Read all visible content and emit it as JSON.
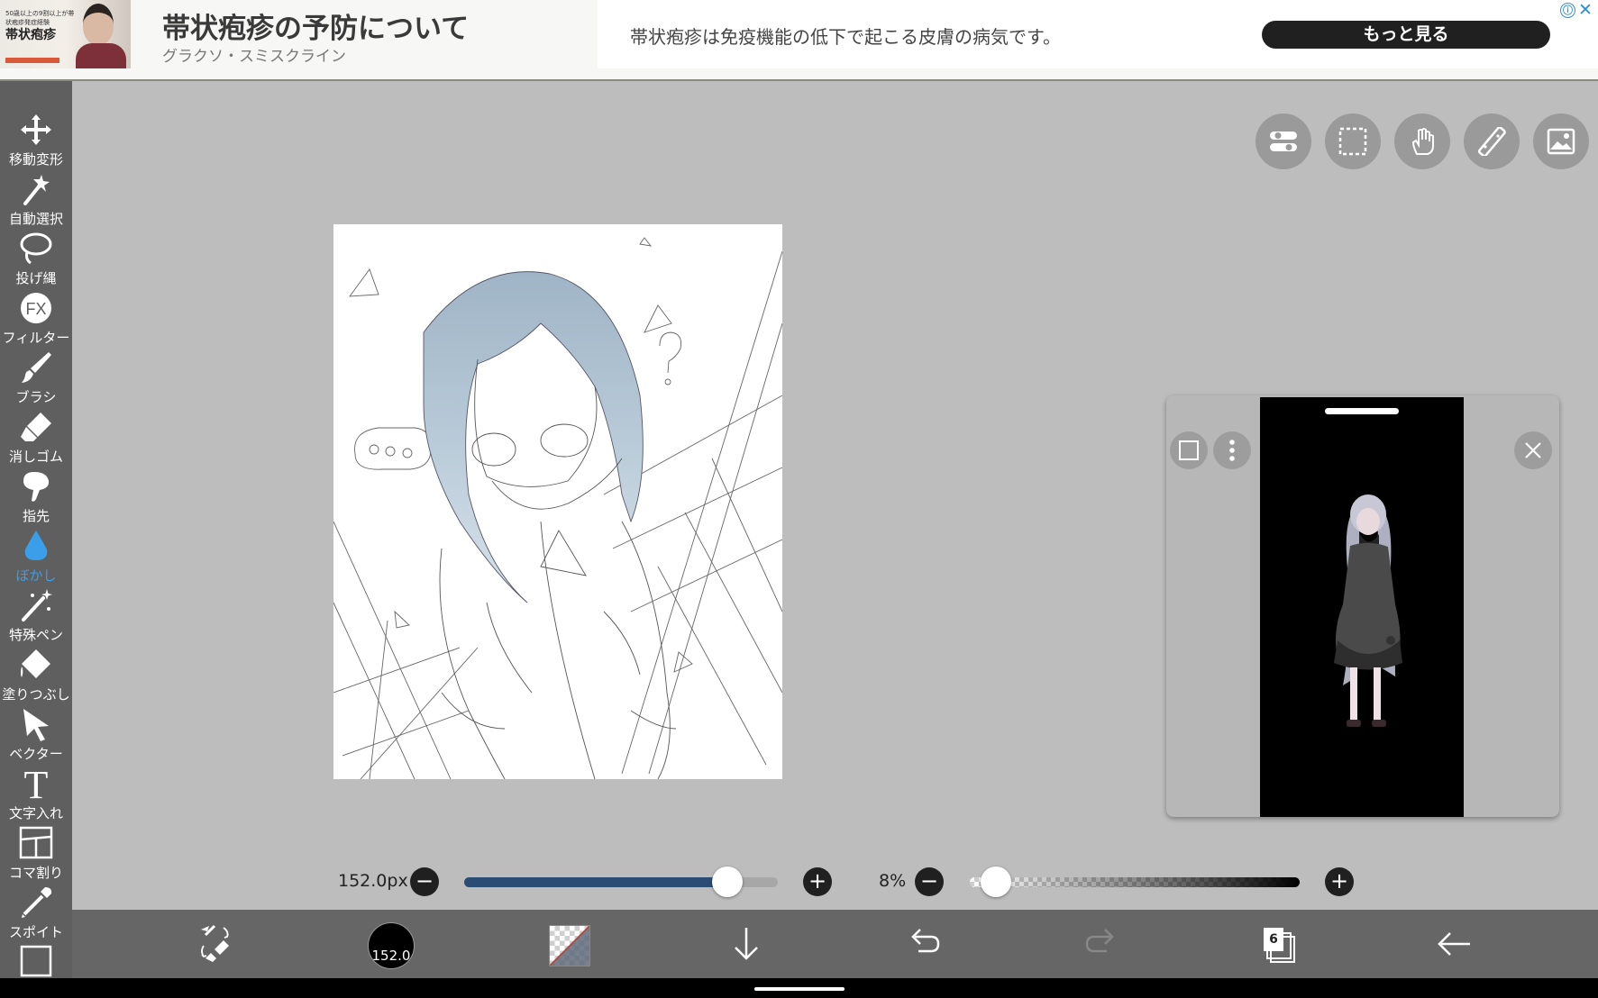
{
  "ad": {
    "thumb_small_text": "50歳以上の9割以上が帯状疱疹発症経験",
    "thumb_main_text": "帯状疱疹",
    "title": "帯状疱疹の予防について",
    "advertiser": "グラクソ・スミスクライン",
    "description": "帯状疱疹は免疫機能の低下で起こる皮膚の病気です。",
    "cta": "もっと見る",
    "info_icon": "ⓘ",
    "close_icon": "✕"
  },
  "tools": [
    {
      "label": "移動変形",
      "icon": "move-icon"
    },
    {
      "label": "自動選択",
      "icon": "magic-wand-icon"
    },
    {
      "label": "投げ縄",
      "icon": "lasso-icon"
    },
    {
      "label": "フィルター",
      "icon": "fx-icon",
      "icon_text": "FX"
    },
    {
      "label": "ブラシ",
      "icon": "brush-icon"
    },
    {
      "label": "消しゴム",
      "icon": "eraser-icon"
    },
    {
      "label": "指先",
      "icon": "finger-icon"
    },
    {
      "label": "ぼかし",
      "icon": "blur-drop-icon",
      "active": true
    },
    {
      "label": "特殊ペン",
      "icon": "special-pen-icon"
    },
    {
      "label": "塗りつぶし",
      "icon": "fill-icon"
    },
    {
      "label": "ベクター",
      "icon": "vector-cursor-icon"
    },
    {
      "label": "文字入れ",
      "icon": "text-icon",
      "icon_text": "T"
    },
    {
      "label": "コマ割り",
      "icon": "frame-divide-icon"
    },
    {
      "label": "スポイト",
      "icon": "eyedropper-icon"
    }
  ],
  "sliders": {
    "size_label": "152.0px",
    "size_fraction": 0.84,
    "opacity_label": "8%",
    "opacity_fraction": 0.08,
    "minus": "−",
    "plus": "+"
  },
  "bottom": {
    "brush_size_text": "152.0",
    "layer_count": "6"
  },
  "colors": {
    "toolbar_bg": "#5f5f5f",
    "active_tool": "#3a9ee8",
    "slider_fill": "#2b4d74",
    "workspace_bg": "#bdbdbd"
  }
}
